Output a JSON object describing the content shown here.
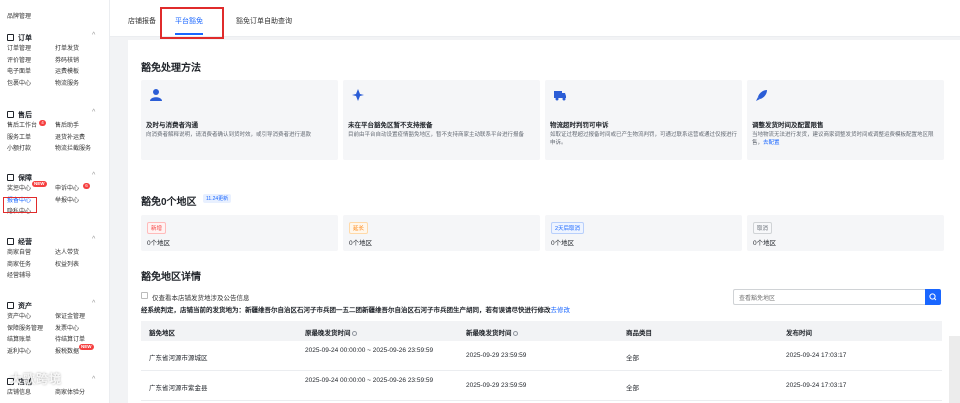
{
  "sidebar": {
    "top_item": "品牌管理",
    "groups": [
      {
        "title": "订单",
        "items": [
          "订单管理",
          "打单发货",
          "评价管理",
          "券码核销",
          "电子面单",
          "运费模板",
          "包裹中心",
          "物流服务"
        ]
      },
      {
        "title": "售后",
        "items": [
          "售后工作台",
          "售后助手",
          "服务工单",
          "退货补运费",
          "小额打款",
          "物流拦截服务"
        ],
        "badge": "4"
      },
      {
        "title": "保障",
        "items": [
          "奖惩中心",
          "申诉中心",
          "报备中心",
          "举报中心",
          "隐私中心"
        ],
        "new_badge": "NEW",
        "num_badge": "6"
      },
      {
        "title": "经营",
        "items": [
          "商家自营",
          "达人带货",
          "商家任务",
          "权益列表",
          "经营辅导"
        ]
      },
      {
        "title": "资产",
        "items": [
          "资产中心",
          "保证金管理",
          "保障服务管理",
          "发票中心",
          "结算账单",
          "待结算订单",
          "返利中心",
          "报税数据"
        ],
        "new_badge": "NEW"
      },
      {
        "title": "店铺",
        "items": [
          "店铺信息",
          "商家体验分"
        ]
      }
    ]
  },
  "tabs": [
    {
      "label": "店铺报备"
    },
    {
      "label": "平台豁免"
    },
    {
      "label": "豁免订单自助查询"
    }
  ],
  "section1": {
    "title": "豁免处理方法",
    "cards": [
      {
        "icon": "user-icon",
        "title": "及时与消费者沟通",
        "desc": "向消费者解释说明，请消费者确认到货时效，或引导消费者进行退款"
      },
      {
        "icon": "pin-icon",
        "title": "未在平台豁免区暂不支持报备",
        "desc": "目前由平台自动设置疫情豁免地区，暂不支持商家主动联系平台进行报备"
      },
      {
        "icon": "truck-icon",
        "title": "物流超时判罚可申诉",
        "desc": "如取证过程超过报备时间或已产生物流判罚，可通过联系运营或通过仅报进行申诉。"
      },
      {
        "icon": "rocket-icon",
        "title": "调整发货时间及配置限售",
        "desc": "当地物流无法进行发货，建议商家调整发货时间或调整运费模板配置地区限售，",
        "link": "去配置"
      }
    ]
  },
  "section2": {
    "title": "豁免0个地区",
    "tag": "11.24更新",
    "stats": [
      {
        "tag": "新增",
        "value": "0个地区",
        "color": "#f53f3f"
      },
      {
        "tag": "延长",
        "value": "0个地区",
        "color": "#ff7d00"
      },
      {
        "tag": "2天后取消",
        "value": "0个地区",
        "color": "#1966ff"
      },
      {
        "tag": "取消",
        "value": "0个地区",
        "color": "#646a73"
      }
    ]
  },
  "section3": {
    "title": "豁免地区详情",
    "checkbox_label": "仅查看本店铺发货地涉及公告信息",
    "rule_text": "经系统判定，店铺当前的发货地为：新疆维吾尔自治区石河子市兵团一五二团新疆维吾尔自治区石河子市兵团生产胡同，若有误请尽快进行修改",
    "rule_link": "去修改",
    "search_placeholder": "查看豁免地区",
    "columns": [
      "豁免地区",
      "原最晚发货时间",
      "新最晚发货时间",
      "商品类目",
      "发布时间"
    ],
    "rows": [
      [
        "广东省河源市源城区",
        "2025-09-24 00:00:00 ~ 2025-09-26 23:59:59",
        "2025-09-29 23:59:59",
        "全部",
        "2025-09-24 17:03:17"
      ],
      [
        "广东省河源市紫金县",
        "2025-09-24 00:00:00 ~ 2025-09-26 23:59:59",
        "2025-09-29 23:59:59",
        "全部",
        "2025-09-24 17:03:17"
      ]
    ]
  },
  "watermark": "大歌跨境",
  "colors": {
    "accent": "#1966ff",
    "highlight": "#e02b2b"
  }
}
